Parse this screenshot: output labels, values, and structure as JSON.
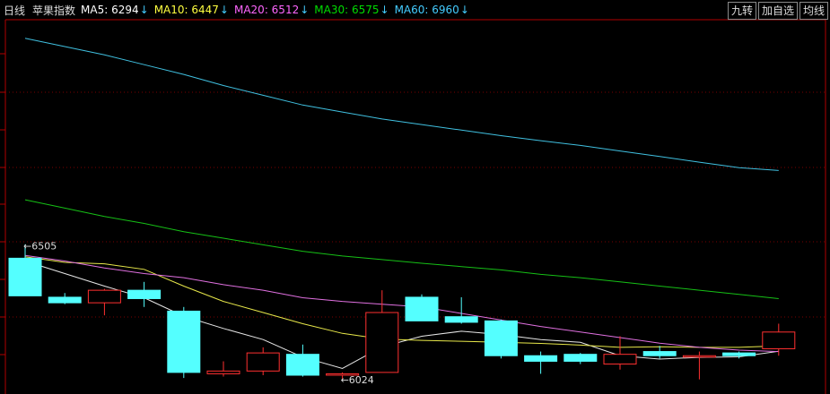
{
  "header": {
    "period_label": "日线",
    "instrument": "苹果指数",
    "ma": [
      {
        "label": "MA5: 6294",
        "arrow": "↓",
        "color": "#ffffff"
      },
      {
        "label": "MA10: 6447",
        "arrow": "↓",
        "color": "#ffff40"
      },
      {
        "label": "MA20: 6512",
        "arrow": "↓",
        "color": "#ff66ff"
      },
      {
        "label": "MA30: 6575",
        "arrow": "↓",
        "color": "#00dd00"
      },
      {
        "label": "MA60: 6960",
        "arrow": "↓",
        "color": "#44ccff"
      }
    ],
    "arrow_color": "#44ccff",
    "buttons": [
      "九转",
      "加自选",
      "均线"
    ]
  },
  "chart_data": {
    "type": "candlestick",
    "ylim": [
      5995,
      7310
    ],
    "grid": true,
    "up_color": "#ff3030",
    "down_color": "#54ffff",
    "candles": [
      {
        "o": 6460,
        "h": 6510,
        "l": 6325,
        "c": 6325
      },
      {
        "o": 6320,
        "h": 6335,
        "l": 6295,
        "c": 6300
      },
      {
        "o": 6300,
        "h": 6350,
        "l": 6255,
        "c": 6345
      },
      {
        "o": 6345,
        "h": 6375,
        "l": 6285,
        "c": 6315
      },
      {
        "o": 6270,
        "h": 6285,
        "l": 6030,
        "c": 6050
      },
      {
        "o": 6045,
        "h": 6090,
        "l": 6035,
        "c": 6055
      },
      {
        "o": 6055,
        "h": 6140,
        "l": 6040,
        "c": 6120
      },
      {
        "o": 6115,
        "h": 6150,
        "l": 6035,
        "c": 6040
      },
      {
        "o": 6040,
        "h": 6050,
        "l": 6024,
        "c": 6045
      },
      {
        "o": 6050,
        "h": 6345,
        "l": 6050,
        "c": 6265
      },
      {
        "o": 6320,
        "h": 6330,
        "l": 6235,
        "c": 6235
      },
      {
        "o": 6250,
        "h": 6320,
        "l": 6225,
        "c": 6230
      },
      {
        "o": 6235,
        "h": 6240,
        "l": 6100,
        "c": 6110
      },
      {
        "o": 6110,
        "h": 6125,
        "l": 6045,
        "c": 6090
      },
      {
        "o": 6115,
        "h": 6120,
        "l": 6080,
        "c": 6090
      },
      {
        "o": 6080,
        "h": 6180,
        "l": 6060,
        "c": 6115
      },
      {
        "o": 6125,
        "h": 6145,
        "l": 6100,
        "c": 6110
      },
      {
        "o": 6105,
        "h": 6125,
        "l": 6025,
        "c": 6110
      },
      {
        "o": 6120,
        "h": 6125,
        "l": 6100,
        "c": 6110
      },
      {
        "o": 6135,
        "h": 6225,
        "l": 6110,
        "c": 6195
      }
    ],
    "series": [
      {
        "name": "MA5",
        "color": "#e6e6e6",
        "values": [
          6450,
          6405,
          6360,
          6318,
          6252,
          6208,
          6168,
          6105,
          6064,
          6142,
          6180,
          6198,
          6186,
          6168,
          6158,
          6110,
          6098,
          6104,
          6106,
          6126
        ]
      },
      {
        "name": "MA10",
        "color": "#e8e84a",
        "values": [
          6465,
          6445,
          6440,
          6420,
          6360,
          6305,
          6265,
          6225,
          6190,
          6170,
          6165,
          6162,
          6158,
          6154,
          6148,
          6140,
          6142,
          6140,
          6140,
          6145
        ]
      },
      {
        "name": "MA20",
        "color": "#e070e0",
        "values": [
          6470,
          6450,
          6425,
          6405,
          6390,
          6365,
          6345,
          6318,
          6305,
          6295,
          6285,
          6262,
          6238,
          6215,
          6195,
          6175,
          6155,
          6140,
          6130,
          6125
        ]
      },
      {
        "name": "MA30",
        "color": "#16c016",
        "values": [
          6670,
          6640,
          6610,
          6585,
          6555,
          6532,
          6508,
          6485,
          6468,
          6455,
          6442,
          6430,
          6418,
          6402,
          6390,
          6375,
          6360,
          6345,
          6330,
          6315
        ]
      },
      {
        "name": "MA60",
        "color": "#40c0e0",
        "values": [
          7250,
          7220,
          7190,
          7155,
          7120,
          7080,
          7045,
          7010,
          6985,
          6960,
          6940,
          6920,
          6900,
          6882,
          6865,
          6845,
          6825,
          6805,
          6785,
          6775
        ]
      }
    ],
    "annotations": [
      {
        "text": "6505",
        "candle": 0,
        "value": 6505
      },
      {
        "text": "6024",
        "candle": 8,
        "value": 6024
      }
    ]
  }
}
